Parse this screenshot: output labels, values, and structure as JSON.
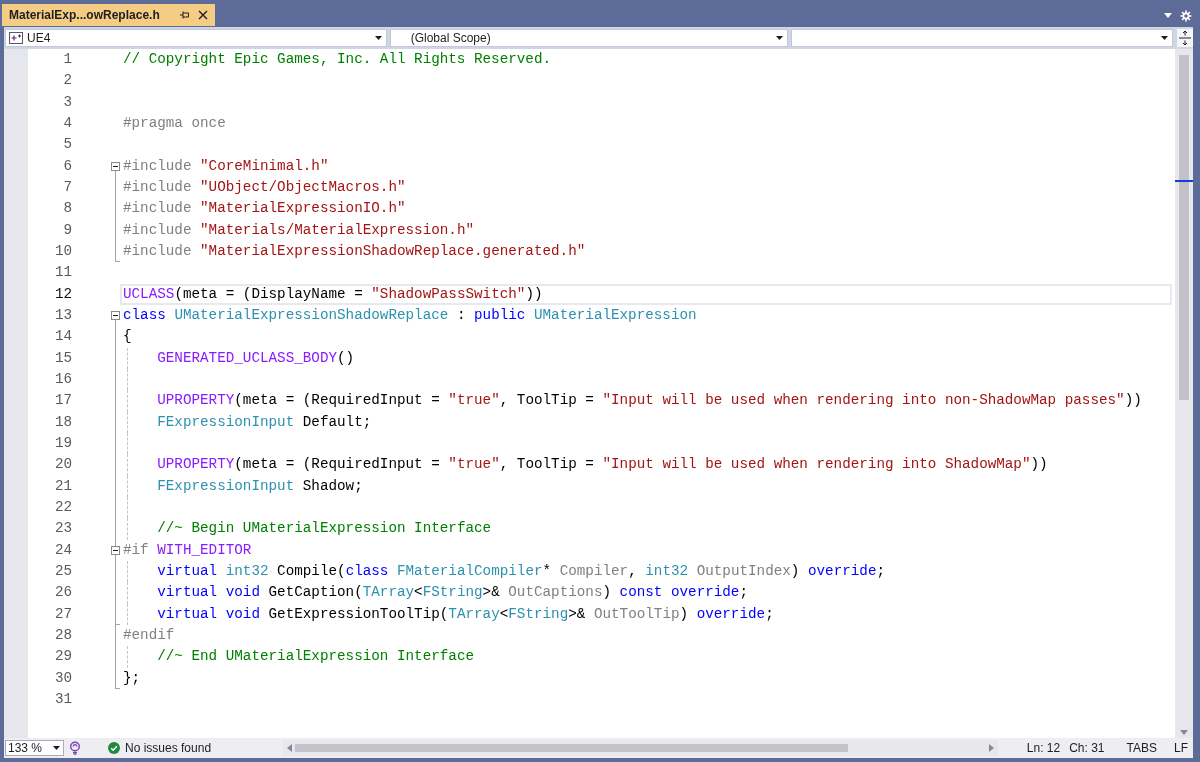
{
  "tabs": [
    {
      "label": "MaterialExp...owReplace.h",
      "selected": true
    }
  ],
  "navigation_bar": {
    "dropdowns": [
      {
        "kind": "project",
        "value": "UE4"
      },
      {
        "kind": "scope",
        "value": "(Global Scope)"
      },
      {
        "kind": "member"
      }
    ]
  },
  "editor": {
    "lines": [
      {
        "number": "1",
        "current": false,
        "tokens": [
          {
            "kind": "comment",
            "text": "// Copyright Epic Games, Inc. All Rights Reserved."
          }
        ]
      },
      {
        "number": "2",
        "current": false
      },
      {
        "number": "3",
        "current": false
      },
      {
        "number": "4",
        "current": false,
        "tokens": [
          {
            "kind": "preprocessor",
            "text": "#pragma once"
          }
        ]
      },
      {
        "number": "5",
        "current": false
      },
      {
        "number": "6",
        "current": false,
        "expanded": true,
        "tokens": [
          {
            "kind": "preprocessor",
            "text": "#include "
          },
          {
            "kind": "string",
            "text": "\"CoreMinimal.h\""
          }
        ],
        "children": [
          {
            "number": "7",
            "current": false,
            "tokens": [
              {
                "kind": "preprocessor",
                "text": "#include "
              },
              {
                "kind": "string",
                "text": "\"UObject/ObjectMacros.h\""
              }
            ]
          },
          {
            "number": "8",
            "current": false,
            "tokens": [
              {
                "kind": "preprocessor",
                "text": "#include "
              },
              {
                "kind": "string",
                "text": "\"MaterialExpressionIO.h\""
              }
            ]
          },
          {
            "number": "9",
            "current": false,
            "tokens": [
              {
                "kind": "preprocessor",
                "text": "#include "
              },
              {
                "kind": "string",
                "text": "\"Materials/MaterialExpression.h\""
              }
            ]
          },
          {
            "number": "10",
            "current": false,
            "tokens": [
              {
                "kind": "preprocessor",
                "text": "#include "
              },
              {
                "kind": "string",
                "text": "\"MaterialExpressionShadowReplace.generated.h\""
              }
            ]
          }
        ]
      },
      {
        "number": "11",
        "current": false
      },
      {
        "number": "12",
        "current": true,
        "tokens": [
          {
            "kind": "macro",
            "text": "UCLASS"
          },
          {
            "kind": "plain",
            "text": "(meta = (DisplayName = "
          },
          {
            "kind": "string",
            "text": "\"ShadowPassSwitch\""
          },
          {
            "kind": "plain",
            "text": "))"
          }
        ]
      },
      {
        "number": "13",
        "current": false,
        "expanded": true,
        "tokens": [
          {
            "kind": "keyword",
            "text": "class "
          },
          {
            "kind": "type",
            "text": "UMaterialExpressionShadowReplace"
          },
          {
            "kind": "plain",
            "text": " : "
          },
          {
            "kind": "keyword",
            "text": "public "
          },
          {
            "kind": "type",
            "text": "UMaterialExpression"
          }
        ],
        "children": [
          {
            "number": "14",
            "current": false,
            "tokens": [
              {
                "kind": "plain",
                "text": "{"
              }
            ]
          },
          {
            "number": "15",
            "current": false,
            "tokens": [
              {
                "kind": "macro",
                "text": "\tGENERATED_UCLASS_BODY"
              },
              {
                "kind": "plain",
                "text": "()"
              }
            ]
          },
          {
            "number": "16",
            "current": false
          },
          {
            "number": "17",
            "current": false,
            "tokens": [
              {
                "kind": "macro",
                "text": "\tUPROPERTY"
              },
              {
                "kind": "plain",
                "text": "(meta = (RequiredInput = "
              },
              {
                "kind": "string",
                "text": "\"true\""
              },
              {
                "kind": "plain",
                "text": ", ToolTip = "
              },
              {
                "kind": "string",
                "text": "\"Input will be used when rendering into non-ShadowMap passes\""
              },
              {
                "kind": "plain",
                "text": "))"
              }
            ]
          },
          {
            "number": "18",
            "current": false,
            "tokens": [
              {
                "kind": "type",
                "text": "\tFExpressionInput"
              },
              {
                "kind": "plain",
                "text": " Default;"
              }
            ]
          },
          {
            "number": "19",
            "current": false
          },
          {
            "number": "20",
            "current": false,
            "tokens": [
              {
                "kind": "macro",
                "text": "\tUPROPERTY"
              },
              {
                "kind": "plain",
                "text": "(meta = (RequiredInput = "
              },
              {
                "kind": "string",
                "text": "\"true\""
              },
              {
                "kind": "plain",
                "text": ", ToolTip = "
              },
              {
                "kind": "string",
                "text": "\"Input will be used when rendering into ShadowMap\""
              },
              {
                "kind": "plain",
                "text": "))"
              }
            ]
          },
          {
            "number": "21",
            "current": false,
            "tokens": [
              {
                "kind": "type",
                "text": "\tFExpressionInput"
              },
              {
                "kind": "plain",
                "text": " Shadow;"
              }
            ]
          },
          {
            "number": "22",
            "current": false
          },
          {
            "number": "23",
            "current": false,
            "tokens": [
              {
                "kind": "comment",
                "text": "\t//~ Begin UMaterialExpression Interface"
              }
            ]
          },
          {
            "number": "24",
            "current": false,
            "expanded": true,
            "tokens": [
              {
                "kind": "preprocessor",
                "text": "#if "
              },
              {
                "kind": "macro",
                "text": "WITH_EDITOR"
              }
            ],
            "children": [
              {
                "number": "25",
                "current": false,
                "tokens": [
                  {
                    "kind": "keyword",
                    "text": "\tvirtual "
                  },
                  {
                    "kind": "type",
                    "text": "int32"
                  },
                  {
                    "kind": "plain",
                    "text": " Compile("
                  },
                  {
                    "kind": "keyword",
                    "text": "class "
                  },
                  {
                    "kind": "type",
                    "text": "FMaterialCompiler"
                  },
                  {
                    "kind": "plain",
                    "text": "* "
                  },
                  {
                    "kind": "parameter",
                    "text": "Compiler"
                  },
                  {
                    "kind": "plain",
                    "text": ", "
                  },
                  {
                    "kind": "type",
                    "text": "int32 "
                  },
                  {
                    "kind": "parameter",
                    "text": "OutputIndex"
                  },
                  {
                    "kind": "plain",
                    "text": ") "
                  },
                  {
                    "kind": "keyword",
                    "text": "override"
                  },
                  {
                    "kind": "plain",
                    "text": ";"
                  }
                ]
              },
              {
                "number": "26",
                "current": false,
                "tokens": [
                  {
                    "kind": "keyword",
                    "text": "\tvirtual void"
                  },
                  {
                    "kind": "plain",
                    "text": " GetCaption("
                  },
                  {
                    "kind": "type",
                    "text": "TArray"
                  },
                  {
                    "kind": "plain",
                    "text": "<"
                  },
                  {
                    "kind": "type",
                    "text": "FString"
                  },
                  {
                    "kind": "plain",
                    "text": ">& "
                  },
                  {
                    "kind": "parameter",
                    "text": "OutCaptions"
                  },
                  {
                    "kind": "plain",
                    "text": ") "
                  },
                  {
                    "kind": "keyword",
                    "text": "const override"
                  },
                  {
                    "kind": "plain",
                    "text": ";"
                  }
                ]
              },
              {
                "number": "27",
                "current": false,
                "tokens": [
                  {
                    "kind": "keyword",
                    "text": "\tvirtual void"
                  },
                  {
                    "kind": "plain",
                    "text": " GetExpressionToolTip("
                  },
                  {
                    "kind": "type",
                    "text": "TArray"
                  },
                  {
                    "kind": "plain",
                    "text": "<"
                  },
                  {
                    "kind": "type",
                    "text": "FString"
                  },
                  {
                    "kind": "plain",
                    "text": ">& "
                  },
                  {
                    "kind": "parameter",
                    "text": "OutToolTip"
                  },
                  {
                    "kind": "plain",
                    "text": ") "
                  },
                  {
                    "kind": "keyword",
                    "text": "override"
                  },
                  {
                    "kind": "plain",
                    "text": ";"
                  }
                ]
              }
            ]
          },
          {
            "number": "28",
            "current": false,
            "tokens": [
              {
                "kind": "preprocessor",
                "text": "#endif"
              }
            ]
          },
          {
            "number": "29",
            "current": false,
            "tokens": [
              {
                "kind": "comment",
                "text": "\t//~ End UMaterialExpression Interface"
              }
            ]
          },
          {
            "number": "30",
            "current": false,
            "tokens": [
              {
                "kind": "plain",
                "text": "};"
              }
            ]
          }
        ]
      },
      {
        "number": "31",
        "current": false
      }
    ]
  },
  "status_bar": {
    "zoom": "133 %",
    "issues": "No issues found",
    "line": "Ln: 12",
    "column": "Ch: 31",
    "indentation": "TABS",
    "line_ending": "LF"
  }
}
